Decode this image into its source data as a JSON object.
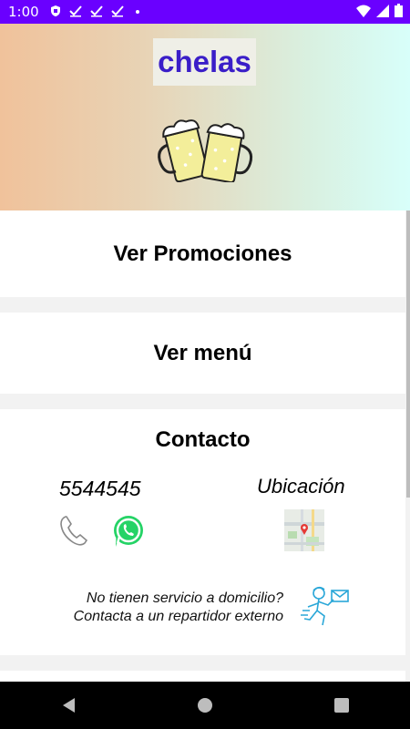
{
  "status_bar": {
    "time": "1:00",
    "left_icons": [
      "shield-icon",
      "check-icon",
      "check-icon",
      "check-icon",
      "dot-icon"
    ],
    "right_icons": [
      "wifi-icon",
      "signal-icon",
      "battery-icon"
    ]
  },
  "header": {
    "brand": "chelas",
    "logo_icon": "beer-mugs-icon",
    "brand_color": "#3a1ec8"
  },
  "menu": {
    "promotions_label": "Ver Promociones",
    "menu_label": "Ver menú"
  },
  "contact": {
    "title": "Contacto",
    "phone": "5544545",
    "location_label": "Ubicación",
    "delivery_line1": "No tienen servicio a domicilio?",
    "delivery_line2": "Contacta a un repartidor externo"
  },
  "colors": {
    "status_bar": "#6a00ff",
    "whatsapp": "#25d366",
    "courier": "#2aa7d8"
  }
}
